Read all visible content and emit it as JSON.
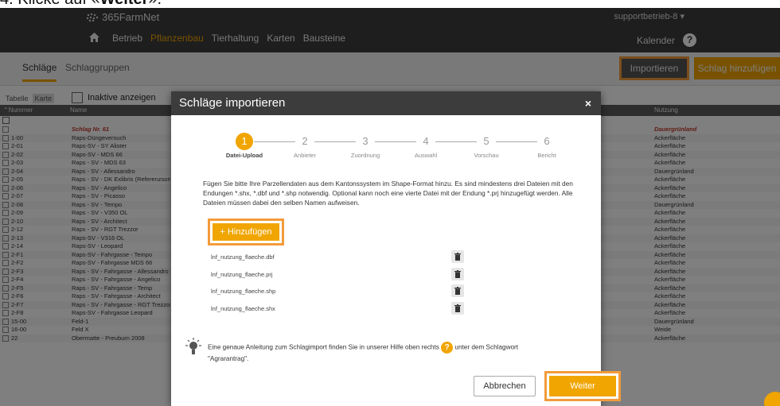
{
  "caption": {
    "prefix": "4. Klicke auf «",
    "bold": "Weiter",
    "suffix": "»."
  },
  "app": {
    "logo": "365FarmNet",
    "user": "supportbetrieb-8 ▾"
  },
  "nav": {
    "items": [
      "Betrieb",
      "Pflanzenbau",
      "Tierhaltung",
      "Karten",
      "Bausteine"
    ],
    "calendar": "Kalender",
    "help": "?"
  },
  "subnav": {
    "tabs": [
      "Schläge",
      "Schlaggruppen"
    ],
    "import_label": "Importieren",
    "add_label": "Schlag hinzufügen"
  },
  "list": {
    "view_tabs": [
      "Tabelle",
      "Karte"
    ],
    "inactive_label": "Inaktive anzeigen",
    "columns": {
      "nummer": "⌃Nummer",
      "name": "Name",
      "nutzung": "Nutzung"
    },
    "rows": [
      {
        "nr": "",
        "name": "Schlag Nr. 61",
        "nutzung": "Dauergrünland"
      },
      {
        "nr": "1-00",
        "name": "Raps-Düngeversuch",
        "nutzung": "Ackerfläche"
      },
      {
        "nr": "2-01",
        "name": "Raps-SV - SY Alister",
        "nutzung": "Ackerfläche"
      },
      {
        "nr": "2-02",
        "name": "Raps-SV - MDS 66",
        "nutzung": "Ackerfläche"
      },
      {
        "nr": "2-03",
        "name": "Raps - SV - MDS 63",
        "nutzung": "Ackerfläche"
      },
      {
        "nr": "2-04",
        "name": "Raps - SV - Allessandro",
        "nutzung": "Dauergrünland"
      },
      {
        "nr": "2-05",
        "name": "Raps - SV - DK Exlibris (Referenzsorte)",
        "nutzung": "Ackerfläche"
      },
      {
        "nr": "2-06",
        "name": "Raps - SV - Angelico",
        "nutzung": "Ackerfläche"
      },
      {
        "nr": "2-07",
        "name": "Raps - SV - Picasso",
        "nutzung": "Ackerfläche"
      },
      {
        "nr": "2-08",
        "name": "Raps - SV - Tempo",
        "nutzung": "Dauergrünland"
      },
      {
        "nr": "2-09",
        "name": "Raps - SV - V350 OL",
        "nutzung": "Ackerfläche"
      },
      {
        "nr": "2-10",
        "name": "Raps - SV - Architect",
        "nutzung": "Ackerfläche"
      },
      {
        "nr": "2-12",
        "name": "Raps - SV - RGT Trezzor",
        "nutzung": "Ackerfläche"
      },
      {
        "nr": "2-13",
        "name": "Raps-SV - V316 OL",
        "nutzung": "Ackerfläche"
      },
      {
        "nr": "2-14",
        "name": "Raps-SV - Leopard",
        "nutzung": "Ackerfläche"
      },
      {
        "nr": "2-F1",
        "name": "Raps-SV - Fahrgasse - Tempo",
        "nutzung": "Ackerfläche"
      },
      {
        "nr": "2-F2",
        "name": "Raps-SV - Fahrgasse MDS 66",
        "nutzung": "Ackerfläche"
      },
      {
        "nr": "2-F3",
        "name": "Raps - SV - Fahrgasse - Allessandro",
        "nutzung": "Ackerfläche"
      },
      {
        "nr": "2-F4",
        "name": "Raps - SV - Fahrgasse - Angelico",
        "nutzung": "Ackerfläche"
      },
      {
        "nr": "2-F5",
        "name": "Raps - SV - Fahrgasse - Temp",
        "nutzung": "Ackerfläche"
      },
      {
        "nr": "2-F6",
        "name": "Raps - SV - Fahrgasse - Architect",
        "nutzung": "Ackerfläche"
      },
      {
        "nr": "2-F7",
        "name": "Raps - SV - Fahrgasse - RGT Trezzor",
        "nutzung": "Ackerfläche"
      },
      {
        "nr": "2-F8",
        "name": "Raps-SV - Fahrgasse Leopard",
        "nutzung": "Ackerfläche"
      },
      {
        "nr": "15-00",
        "name": "Feld-1",
        "nutzung": "Dauergrünland"
      },
      {
        "nr": "16-00",
        "name": "Feld X",
        "nutzung": "Weide"
      },
      {
        "nr": "22",
        "name": "Obermatte - Preuburn 2008",
        "nutzung": "Ackerfläche"
      }
    ]
  },
  "modal": {
    "title": "Schläge importieren",
    "close": "×",
    "steps": [
      {
        "num": "1",
        "label": "Datei-Upload",
        "active": true
      },
      {
        "num": "2",
        "label": "Anbieter",
        "active": false
      },
      {
        "num": "3",
        "label": "Zuordnung",
        "active": false
      },
      {
        "num": "4",
        "label": "Auswahl",
        "active": false
      },
      {
        "num": "5",
        "label": "Vorschau",
        "active": false
      },
      {
        "num": "6",
        "label": "Bericht",
        "active": false
      }
    ],
    "intro": "Fügen Sie bitte Ihre Parzellendaten aus dem Kantonssystem im Shape-Format hinzu. Es sind mindestens drei Dateien mit den Endungen *.shx, *.dbf und *.shp notwendig. Optional kann noch eine vierte Datei mit der Endung *.prj hinzugefügt werden. Alle Dateien müssen dabei den selben Namen aufweisen.",
    "add_button": "+ Hinzufügen",
    "files": [
      "lnf_nutzung_flaeche.dbf",
      "lnf_nutzung_flaeche.prj",
      "lnf_nutzung_flaeche.shp",
      "lnf_nutzung_flaeche.shx"
    ],
    "tip_before": "Eine genaue Anleitung zum Schlagimport finden Sie in unserer Hilfe oben rechts",
    "tip_help": "?",
    "tip_after": "unter dem Schlagwort",
    "tip_line2": "\"Agrarantrag\".",
    "cancel_label": "Abbrechen",
    "next_label": "Weiter"
  }
}
